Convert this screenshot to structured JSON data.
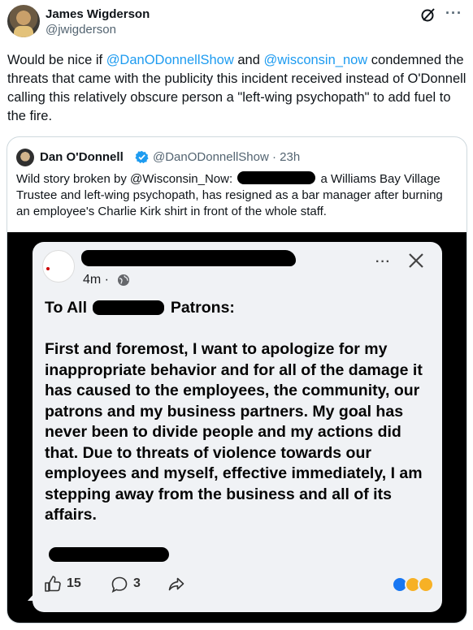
{
  "author": {
    "name": "James Wigderson",
    "handle": "@jwigderson"
  },
  "tweet": {
    "part1": "Would be nice if ",
    "mention1": "@DanODonnellShow",
    "part2": " and ",
    "mention2": "@wisconsin_now",
    "part3": " condemned the threats that came with the publicity this incident received instead of O'Donnell calling this relatively obscure person a \"left-wing psychopath\" to add fuel to the fire."
  },
  "quote": {
    "name": "Dan O'Donnell",
    "handle_time": "@DanODonnellShow · 23h",
    "text_before": "Wild story broken by @Wisconsin_Now: ",
    "text_after": " a Williams Bay Village Trustee and left-wing psychopath, has resigned as a bar manager after burning an employee's Charlie Kirk shirt in front of the whole staff."
  },
  "fb_post": {
    "time": "4m ·",
    "greeting_before": "To All ",
    "greeting_after": " Patrons:",
    "body": "First and foremost, I want to apologize for my inappropriate behavior and for all of the damage it has caused to the employees, the community, our patrons and my business partners.  My goal has never been to divide people and my actions did that. Due to threats of violence towards our employees and myself, effective immediately, I am stepping away from the business and all of its affairs.",
    "likes": "15",
    "comments": "3",
    "more_label": "···"
  },
  "header_more_label": "···",
  "colors": {
    "link": "#1d9bf0",
    "verified": "#1d9bf0",
    "fb_like": "#1877f2"
  }
}
